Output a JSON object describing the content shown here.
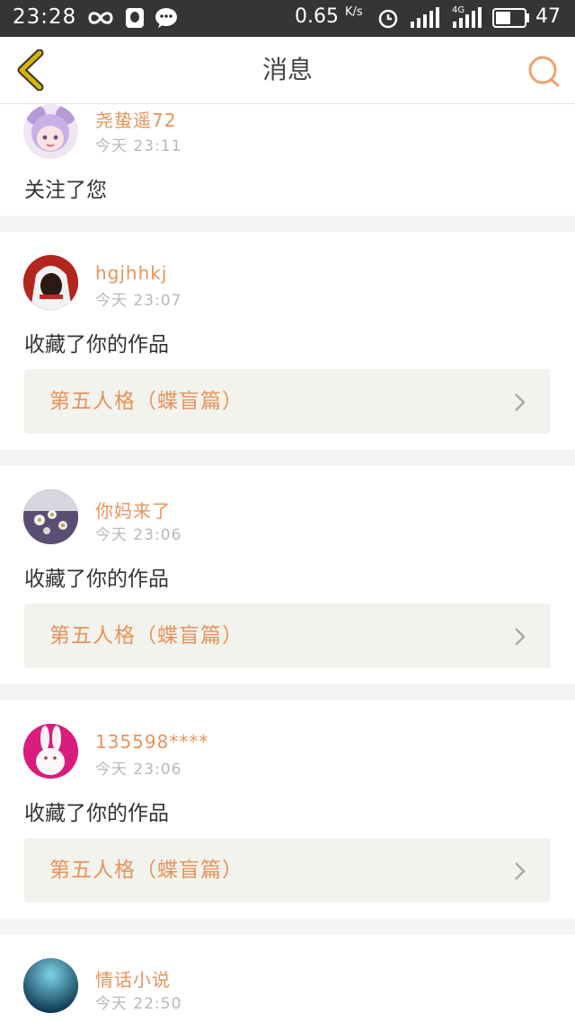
{
  "status_bar": {
    "time": "23:28",
    "speed_value": "0.65",
    "speed_unit": "K/s",
    "network": "4G",
    "battery": "47"
  },
  "header": {
    "title": "消息",
    "back_icon": "chevron-left-icon",
    "search_icon": "search-icon"
  },
  "colors": {
    "accent": "#e8935a",
    "back_icon": "#c8a200",
    "card_bg": "#ffffff",
    "page_bg": "#f4f4f4",
    "work_bg": "#f3f3ee"
  },
  "messages": [
    {
      "username": "尧蛰遥72",
      "time": "今天 23:11",
      "action": "关注了您"
    },
    {
      "username": "hgjhhkj",
      "time": "今天 23:07",
      "action": "收藏了你的作品",
      "work_title": "第五人格（蝶盲篇）"
    },
    {
      "username": "你妈来了",
      "time": "今天 23:06",
      "action": "收藏了你的作品",
      "work_title": "第五人格（蝶盲篇）"
    },
    {
      "username": "135598****",
      "time": "今天 23:06",
      "action": "收藏了你的作品",
      "work_title": "第五人格（蝶盲篇）"
    },
    {
      "username": "情话小说",
      "time": "今天 22:50"
    }
  ]
}
